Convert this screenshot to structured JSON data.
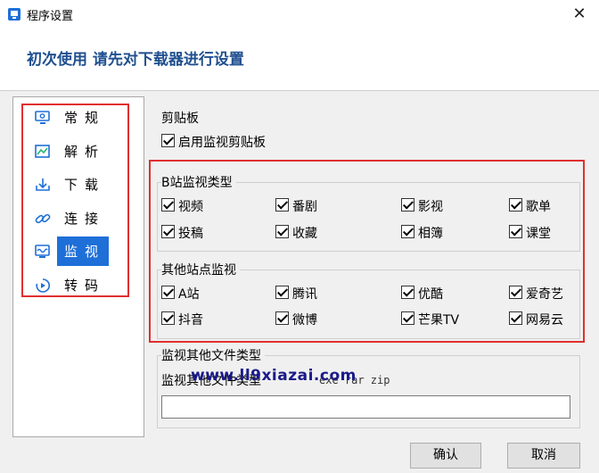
{
  "window": {
    "title": "程序设置"
  },
  "banner": {
    "text": "初次使用 请先对下载器进行设置"
  },
  "sidebar": {
    "items": [
      {
        "label": "常规",
        "icon": "monitor-gear-icon"
      },
      {
        "label": "解析",
        "icon": "chart-icon"
      },
      {
        "label": "下载",
        "icon": "download-icon"
      },
      {
        "label": "连接",
        "icon": "link-icon"
      },
      {
        "label": "监视",
        "icon": "monitor-wave-icon",
        "selected": true
      },
      {
        "label": "转码",
        "icon": "convert-icon"
      }
    ]
  },
  "clipboard": {
    "title": "剪贴板",
    "enable_label": "启用监视剪贴板",
    "checked": true
  },
  "bilibili": {
    "title": "B站监视类型",
    "options": [
      "视频",
      "番剧",
      "影视",
      "歌单",
      "投稿",
      "收藏",
      "相簿",
      "课堂"
    ]
  },
  "other_sites": {
    "title": "其他站点监视",
    "options": [
      "A站",
      "腾讯",
      "优酷",
      "爱奇艺",
      "抖音",
      "微博",
      "芒果TV",
      "网易云"
    ]
  },
  "other_files": {
    "title": "监视其他文件类型",
    "field_label": "监视其他文件类型",
    "hint": "exe rar zip",
    "value": ""
  },
  "watermark": "www.ll9xiazai.com",
  "buttons": {
    "ok": "确认",
    "cancel": "取消"
  },
  "colors": {
    "accent": "#1e6fd8",
    "banner_text": "#1f4f8f",
    "highlight": "#e03030"
  }
}
